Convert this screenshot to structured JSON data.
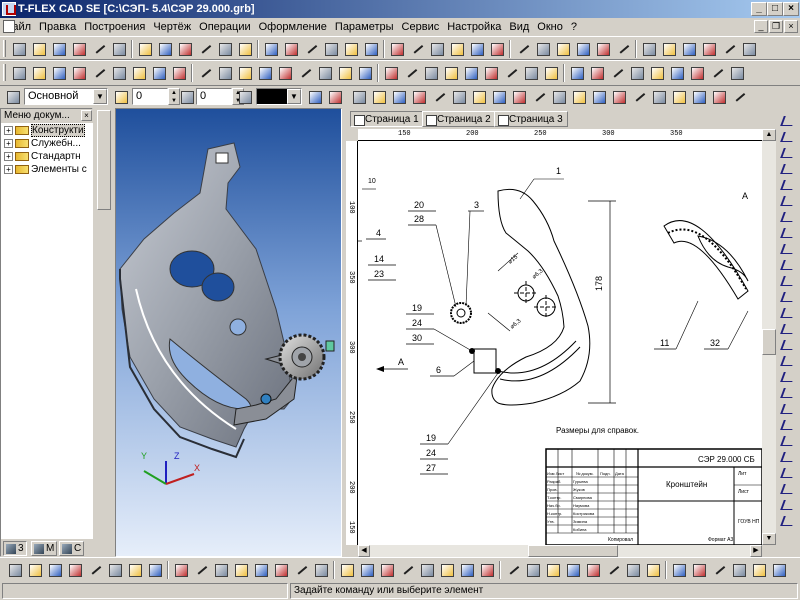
{
  "window": {
    "title": "T-FLEX CAD SE [C:\\СЭП- 5.4\\СЭР 29.000.grb]",
    "minimize": "_",
    "maximize": "□",
    "close": "×"
  },
  "menu": [
    "Файл",
    "Правка",
    "Построения",
    "Чертёж",
    "Операции",
    "Оформление",
    "Параметры",
    "Сервис",
    "Настройка",
    "Вид",
    "Окно",
    "?"
  ],
  "properties_bar": {
    "layer": "Основной",
    "level": "0",
    "priority": "0"
  },
  "left_panel": {
    "title": "Меню докум...",
    "close": "×",
    "items": [
      "Конструкти",
      "Служебн...",
      "Стандартн",
      "Элементы с"
    ],
    "tabs": [
      "3",
      "М",
      "С"
    ]
  },
  "view3d": {
    "axes": {
      "x": "X",
      "y": "Y",
      "z": "Z"
    }
  },
  "drawing": {
    "tabs": [
      "Страница 1",
      "Страница 2",
      "Страница 3"
    ],
    "hruler": [
      "150",
      "200",
      "250",
      "300",
      "350"
    ],
    "vruler": [
      "100",
      "350",
      "300",
      "250",
      "200",
      "150"
    ],
    "view_label": "А",
    "side_arrow_label": "А",
    "callouts": {
      "part_1": "1",
      "part_3": "3",
      "part_4": "4",
      "part_6": "6",
      "part_11": "11",
      "part_32": "32",
      "stack_a_top": "20",
      "stack_a_bot": "28",
      "stack_b_top": "14",
      "stack_b_bot": "23",
      "stack_c_1": "19",
      "stack_c_2": "24",
      "stack_c_3": "30",
      "stack_d_1": "19",
      "stack_d_2": "24",
      "stack_d_3": "27"
    },
    "dimensions": {
      "height": "178",
      "small_dim": "10",
      "hole_d1": "⌀15",
      "hole_d2": "⌀6,3",
      "hole_d3": "⌀6,3"
    },
    "note": "Размеры для справок.",
    "title_block": {
      "designation": "СЭР 29.000 СБ",
      "name": "Кронштейн",
      "rows": [
        "Изм Лист",
        "Разраб.",
        "Пров.",
        "Т.контр.",
        "Нач.бр.",
        "Н.контр.",
        "Утв."
      ],
      "people": [
        "Гурьева",
        "Жуков",
        "Смирнова",
        "Наумова",
        "Кострикова",
        "Зимина",
        "Кобина"
      ],
      "headers": [
        "№ докум.",
        "Подп.",
        "Дата"
      ],
      "lit": "Лит",
      "sheet": "Лист",
      "org": "ГОУВ НП",
      "copied": "Копировал",
      "format": "Формат А3"
    }
  },
  "statusbar": {
    "message": "Задайте команду или выберите элемент"
  }
}
